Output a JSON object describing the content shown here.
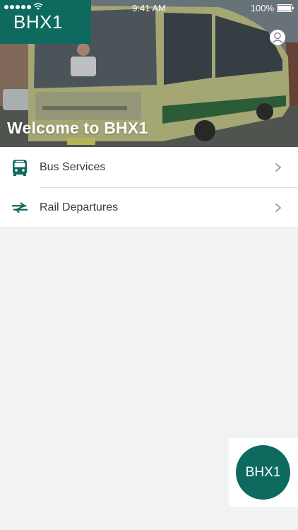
{
  "status_bar": {
    "time": "9:41 AM",
    "battery": "100%"
  },
  "logo": {
    "text": "BHX1"
  },
  "hero": {
    "title": "Welcome to BHX1"
  },
  "menu": {
    "items": [
      {
        "label": "Bus Services",
        "icon": "bus-icon"
      },
      {
        "label": "Rail Departures",
        "icon": "rail-icon"
      }
    ]
  },
  "fab": {
    "label": "BHX1"
  },
  "colors": {
    "brand": "#0e6a5e",
    "background": "#f1f2f4"
  }
}
